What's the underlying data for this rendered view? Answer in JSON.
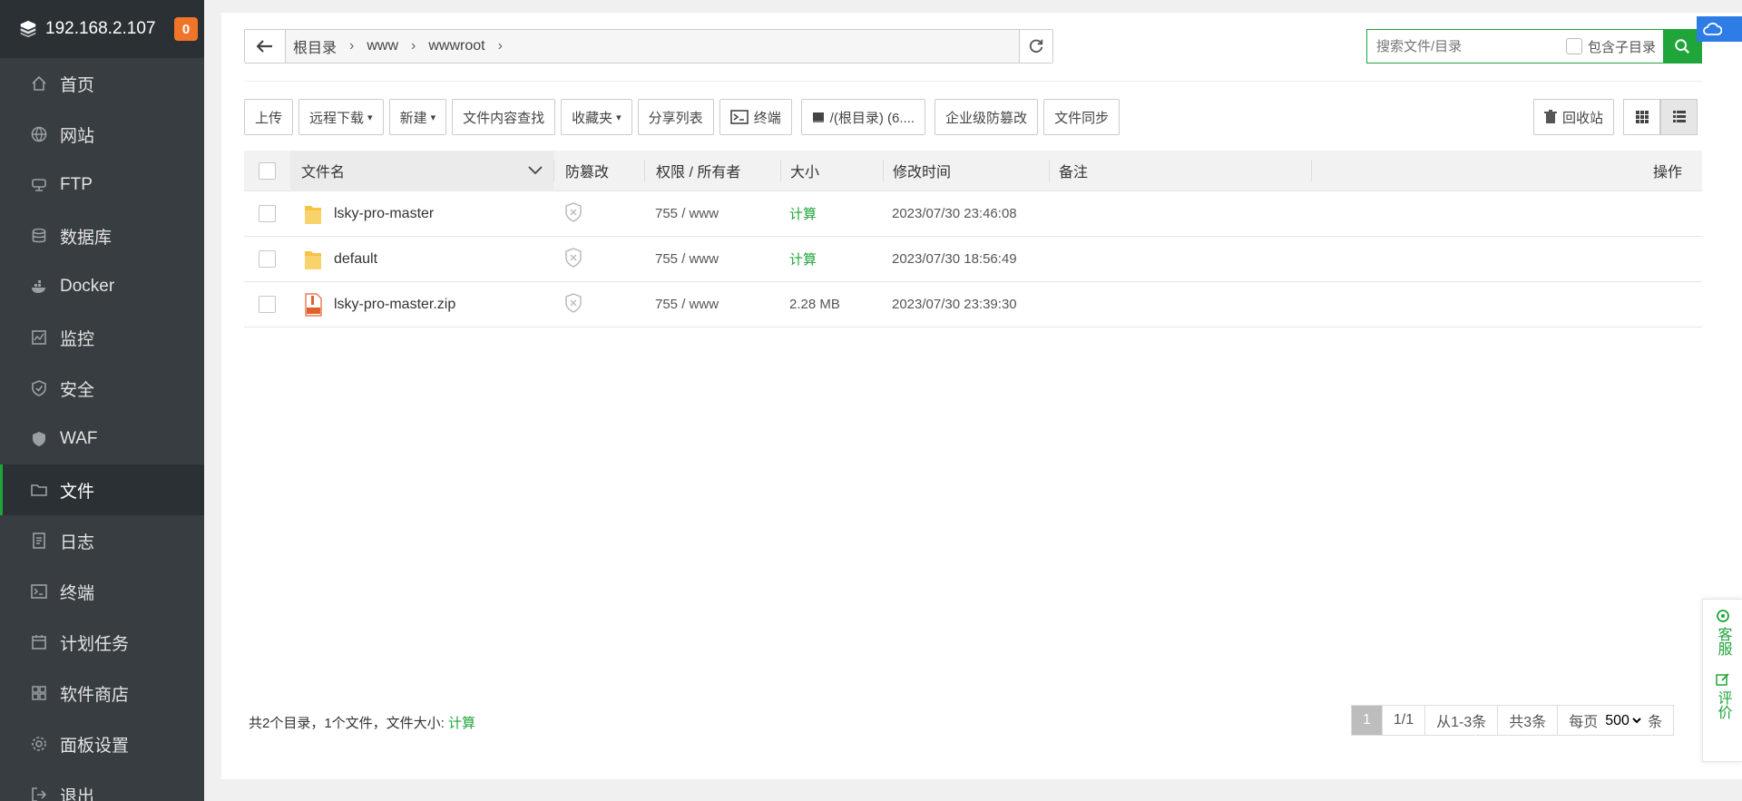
{
  "sidebar": {
    "ip": "192.168.2.107",
    "badge": "0",
    "items": [
      {
        "label": "首页",
        "icon": "home-icon"
      },
      {
        "label": "网站",
        "icon": "globe-icon"
      },
      {
        "label": "FTP",
        "icon": "ftp-icon"
      },
      {
        "label": "数据库",
        "icon": "database-icon"
      },
      {
        "label": "Docker",
        "icon": "docker-icon"
      },
      {
        "label": "监控",
        "icon": "monitor-icon"
      },
      {
        "label": "安全",
        "icon": "shield-icon"
      },
      {
        "label": "WAF",
        "icon": "waf-icon"
      },
      {
        "label": "文件",
        "icon": "folder-icon",
        "active": true
      },
      {
        "label": "日志",
        "icon": "log-icon"
      },
      {
        "label": "终端",
        "icon": "terminal-icon"
      },
      {
        "label": "计划任务",
        "icon": "calendar-icon"
      },
      {
        "label": "软件商店",
        "icon": "apps-icon"
      },
      {
        "label": "面板设置",
        "icon": "gear-icon"
      },
      {
        "label": "退出",
        "icon": "logout-icon"
      }
    ]
  },
  "path": {
    "crumbs": [
      "根目录",
      "www",
      "wwwroot"
    ]
  },
  "search": {
    "placeholder": "搜索文件/目录",
    "include_sub": "包含子目录"
  },
  "toolbar": {
    "upload": "上传",
    "remote_download": "远程下载",
    "new": "新建",
    "content_search": "文件内容查找",
    "favorites": "收藏夹",
    "share_list": "分享列表",
    "terminal": "终端",
    "disk": "/(根目录) (6....",
    "tamper_proof": "企业级防篡改",
    "file_sync": "文件同步",
    "recycle_bin": "回收站"
  },
  "table": {
    "headers": {
      "name": "文件名",
      "tamper": "防篡改",
      "perm": "权限 / 所有者",
      "size": "大小",
      "mtime": "修改时间",
      "note": "备注",
      "op": "操作"
    },
    "rows": [
      {
        "name": "lsky-pro-master",
        "type": "folder",
        "perm": "755 / www",
        "size": "计算",
        "mtime": "2023/07/30 23:46:08"
      },
      {
        "name": "default",
        "type": "folder",
        "perm": "755 / www",
        "size": "计算",
        "mtime": "2023/07/30 18:56:49"
      },
      {
        "name": "lsky-pro-master.zip",
        "type": "zip",
        "perm": "755 / www",
        "size": "2.28 MB",
        "mtime": "2023/07/30 23:39:30"
      }
    ]
  },
  "footer": {
    "summary": "共2个目录，1个文件，文件大小:",
    "summary_link": "计算",
    "page_current": "1",
    "page_of": "1/1",
    "range": "从1-3条",
    "total": "共3条",
    "per_page_label": "每页",
    "per_page_value": "500",
    "per_page_unit": "条"
  },
  "float": {
    "service": "客服",
    "review": "评价"
  },
  "colors": {
    "accent": "#20a53a",
    "sidebar": "#373d41",
    "badge": "#f0752b"
  }
}
